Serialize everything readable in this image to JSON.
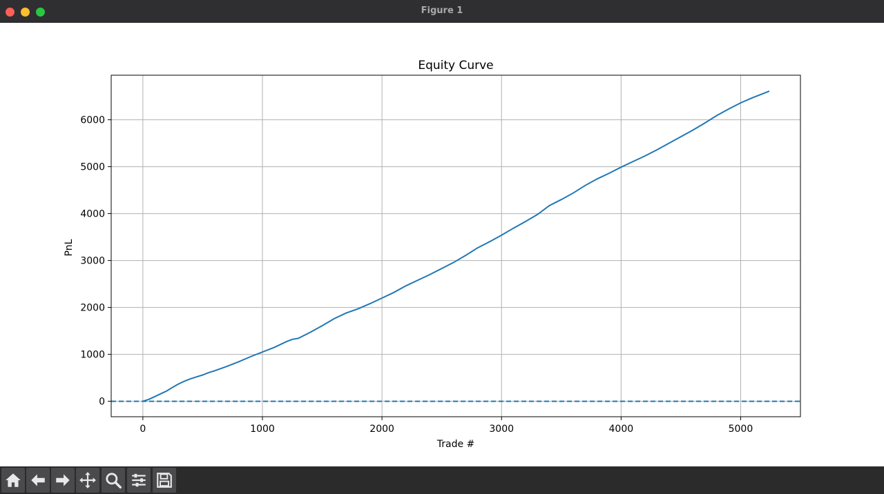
{
  "window": {
    "title": "Figure 1"
  },
  "toolbar": {
    "icons": [
      "home-icon",
      "back-arrow-icon",
      "forward-arrow-icon",
      "pan-icon",
      "zoom-icon",
      "configure-subplots-icon",
      "save-icon"
    ]
  },
  "colors": {
    "line": "#1f77b4",
    "grid": "#b0b0b0",
    "titlebar": "#2f2f31",
    "toolbar": "#2b2b2b"
  },
  "chart_data": {
    "type": "line",
    "title": "Equity Curve",
    "xlabel": "Trade #",
    "ylabel": "PnL",
    "xlim": [
      -265,
      5500
    ],
    "ylim": [
      -330,
      6950
    ],
    "xticks": [
      0,
      1000,
      2000,
      3000,
      4000,
      5000
    ],
    "yticks": [
      0,
      1000,
      2000,
      3000,
      4000,
      5000,
      6000
    ],
    "grid": true,
    "series": [
      {
        "style": "solid",
        "x": [
          0,
          50,
          100,
          150,
          200,
          250,
          300,
          350,
          400,
          450,
          500,
          550,
          600,
          700,
          800,
          900,
          1000,
          1100,
          1200,
          1250,
          1300,
          1400,
          1500,
          1600,
          1700,
          1800,
          1900,
          2000,
          2100,
          2200,
          2300,
          2400,
          2500,
          2600,
          2700,
          2800,
          2900,
          3000,
          3100,
          3200,
          3300,
          3400,
          3500,
          3600,
          3700,
          3800,
          3900,
          4000,
          4100,
          4200,
          4300,
          4400,
          4500,
          4600,
          4700,
          4800,
          4900,
          5000,
          5100,
          5200,
          5240
        ],
        "y": [
          0,
          40,
          100,
          160,
          220,
          300,
          370,
          430,
          480,
          520,
          560,
          610,
          650,
          740,
          840,
          950,
          1050,
          1150,
          1270,
          1320,
          1340,
          1470,
          1610,
          1760,
          1880,
          1970,
          2080,
          2200,
          2320,
          2460,
          2580,
          2700,
          2830,
          2960,
          3110,
          3270,
          3400,
          3540,
          3690,
          3830,
          3980,
          4170,
          4300,
          4440,
          4600,
          4740,
          4860,
          4990,
          5110,
          5230,
          5360,
          5500,
          5640,
          5780,
          5930,
          6090,
          6230,
          6360,
          6470,
          6570,
          6610
        ]
      },
      {
        "style": "dashed",
        "x": [
          -265,
          5500
        ],
        "y": [
          0,
          0
        ]
      }
    ]
  }
}
